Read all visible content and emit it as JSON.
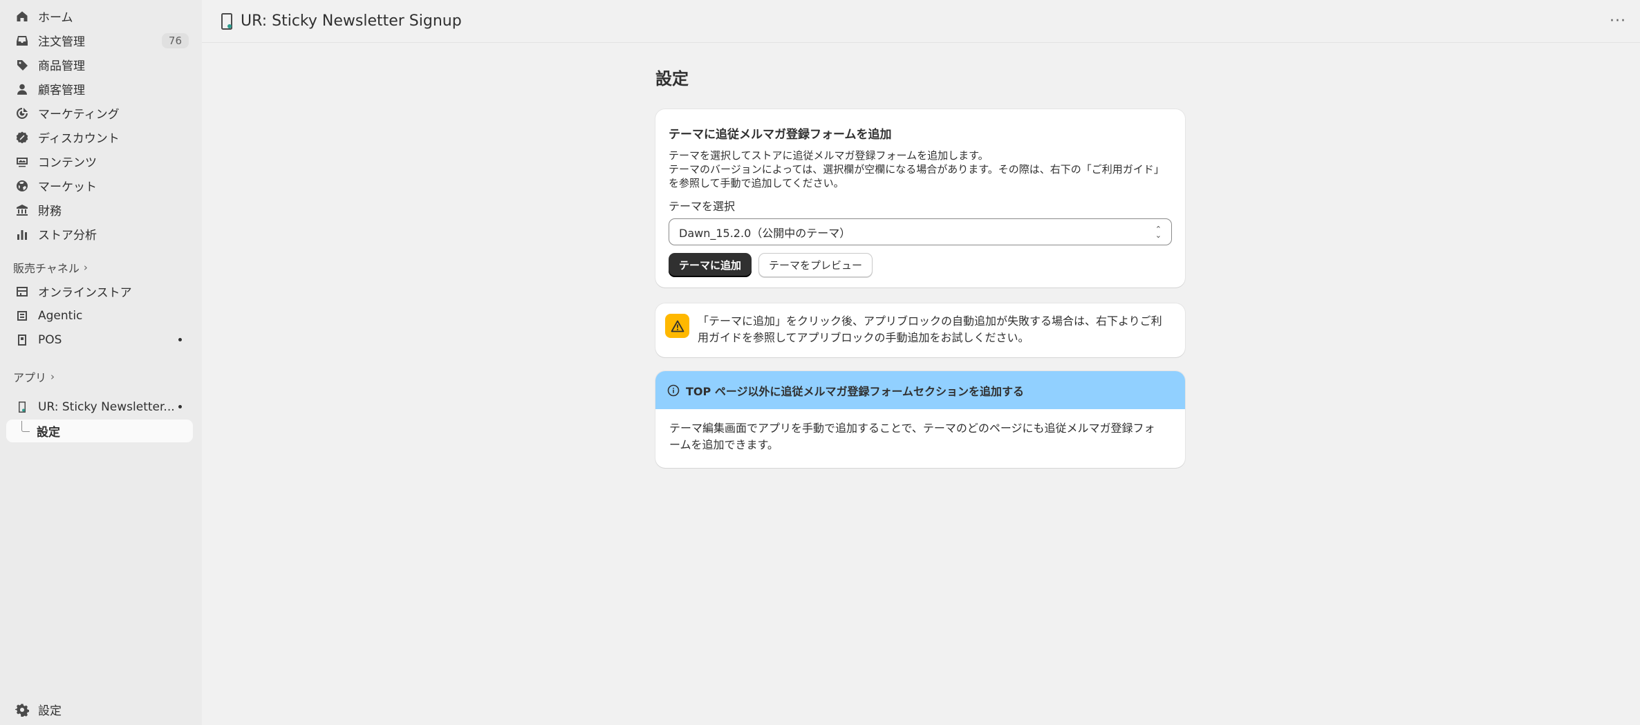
{
  "sidebar": {
    "items": [
      {
        "label": "ホーム",
        "icon": "home-icon"
      },
      {
        "label": "注文管理",
        "icon": "inbox-icon",
        "badge": "76"
      },
      {
        "label": "商品管理",
        "icon": "tag-icon"
      },
      {
        "label": "顧客管理",
        "icon": "person-icon"
      },
      {
        "label": "マーケティング",
        "icon": "target-icon"
      },
      {
        "label": "ディスカウント",
        "icon": "discount-icon"
      },
      {
        "label": "コンテンツ",
        "icon": "content-icon"
      },
      {
        "label": "マーケット",
        "icon": "globe-icon"
      },
      {
        "label": "財務",
        "icon": "bank-icon"
      },
      {
        "label": "ストア分析",
        "icon": "chart-icon"
      }
    ],
    "sales_channels_title": "販売チャネル",
    "channels": [
      {
        "label": "オンラインストア",
        "icon": "store-icon"
      },
      {
        "label": "Agentic",
        "icon": "agentic-icon"
      },
      {
        "label": "POS",
        "icon": "pos-icon"
      }
    ],
    "apps_title": "アプリ",
    "app_item": {
      "label": "UR: Sticky Newsletter..."
    },
    "app_sub_item": {
      "label": "設定"
    },
    "settings": {
      "label": "設定"
    }
  },
  "header": {
    "title": "UR: Sticky Newsletter Signup",
    "more": "···"
  },
  "main": {
    "page_title": "設定",
    "card1": {
      "title": "テーマに追従メルマガ登録フォームを追加",
      "desc_line1": "テーマを選択してストアに追従メルマガ登録フォームを追加します。",
      "desc_line2": "テーマのバージョンによっては、選択欄が空欄になる場合があります。その際は、右下の「ご利用ガイド」",
      "desc_line3": "を参照して手動で追加してください。",
      "select_label": "テーマを選択",
      "select_value": "Dawn_15.2.0（公開中のテーマ）",
      "add_button": "テーマに追加",
      "preview_button": "テーマをプレビュー"
    },
    "warning": {
      "line1": "「テーマに追加」をクリック後、アプリブロックの自動追加が失敗する場合は、右下よりご利",
      "line2": "用ガイドを参照してアプリブロックの手動追加をお試しください。"
    },
    "info": {
      "title": "TOP ページ以外に追従メルマガ登録フォームセクションを追加する",
      "line1": "テーマ編集画面でアプリを手動で追加することで、テーマのどのページにも追従メルマガ登録フォ",
      "line2": "ームを追加できます。"
    }
  },
  "colors": {
    "sidebar_bg": "#ebebeb",
    "page_bg": "#f1f1f1",
    "primary_button": "#303030",
    "warning_icon_bg": "#ffb800",
    "info_banner_bg": "#91d0ff"
  }
}
